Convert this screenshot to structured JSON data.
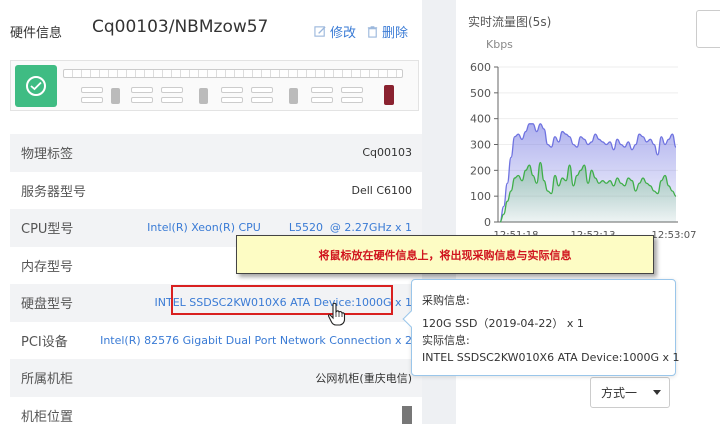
{
  "header": {
    "section_title": "硬件信息",
    "hostname": "Cq00103/NBMzow57",
    "edit_label": "修改",
    "delete_label": "删除"
  },
  "hardware_rows": [
    {
      "label": "物理标签",
      "value": "Cq00103"
    },
    {
      "label": "服务器型号",
      "value": "Dell C6100"
    },
    {
      "label": "CPU型号",
      "value": "Intel(R) Xeon(R) CPU        L5520  @ 2.27GHz x 1"
    },
    {
      "label": "内存型号",
      "value": ""
    },
    {
      "label": "硬盘型号",
      "value": "INTEL SSDSC2KW010X6 ATA Device:1000G x 1"
    },
    {
      "label": "PCI设备",
      "value": "Intel(R) 82576 Gigabit Dual Port Network Connection x 2"
    },
    {
      "label": "所属机柜",
      "value": "公网机柜(重庆电信)"
    },
    {
      "label": "机柜位置",
      "value": ""
    }
  ],
  "realtime": {
    "title": "实时流量图(5s)",
    "unit": "Kbps",
    "select_value": "方式一"
  },
  "chart_data": {
    "type": "area",
    "ylabel": "Kbps",
    "ylim": [
      0,
      600
    ],
    "yticks": [
      0,
      100,
      200,
      300,
      400,
      500,
      600
    ],
    "xticks": [
      "12:51:18",
      "12:52:13",
      "12:53:07"
    ],
    "series": [
      {
        "color": "#6f73e0",
        "values": [
          0,
          60,
          150,
          250,
          330,
          340,
          320,
          350,
          380,
          380,
          350,
          380,
          360,
          300,
          290,
          330,
          310,
          350,
          340,
          330,
          300,
          290,
          330,
          320,
          300,
          310,
          340,
          320,
          310,
          300,
          310,
          280,
          320,
          300,
          290,
          310,
          280,
          300,
          340,
          330,
          310,
          320,
          300,
          260,
          330,
          300,
          320,
          340,
          290
        ]
      },
      {
        "color": "#3fae49",
        "values": [
          0,
          30,
          80,
          120,
          170,
          180,
          160,
          200,
          220,
          180,
          150,
          230,
          160,
          120,
          110,
          180,
          140,
          170,
          160,
          220,
          140,
          180,
          200,
          220,
          150,
          200,
          170,
          150,
          160,
          150,
          160,
          140,
          170,
          150,
          140,
          170,
          160,
          120,
          150,
          170,
          150,
          140,
          120,
          110,
          160,
          180,
          140,
          120,
          100
        ]
      }
    ]
  },
  "tip": {
    "text": "将鼠标放在硬件信息上，将出现采购信息与实际信息"
  },
  "popover": {
    "purchase_label": "采购信息:",
    "purchase_value": "120G SSD（2019-04-22） x 1",
    "actual_label": "实际信息:",
    "actual_value": "INTEL SSDSC2KW010X6 ATA Device:1000G x 1"
  },
  "colors": {
    "accent": "#3a7bd5",
    "status_ok": "#3fbc83",
    "tip_text": "#d0141e",
    "highlight_border": "#d92020"
  }
}
